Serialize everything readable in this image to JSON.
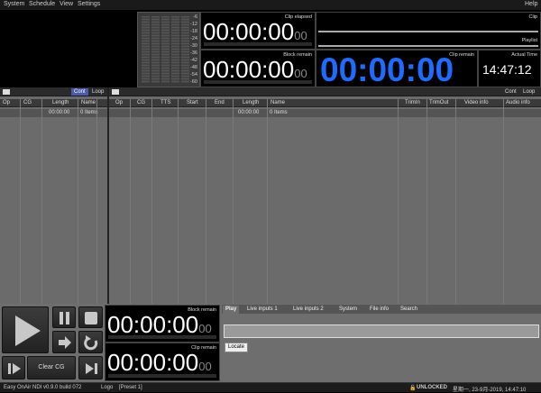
{
  "menu": {
    "items": [
      "System",
      "Schedule",
      "View",
      "Settings"
    ],
    "help": "Help"
  },
  "vu_scale": [
    "-6",
    "-12",
    "-18",
    "-24",
    "-30",
    "-36",
    "-42",
    "-48",
    "-54",
    "-60"
  ],
  "timers": {
    "clip_elapsed": {
      "label": "Clip elapsed",
      "main": "00:00:00",
      "frames": "00"
    },
    "block_remain": {
      "label": "Block remain",
      "main": "00:00:00",
      "frames": "00"
    },
    "clip_remain": {
      "label": "Clip remain",
      "value": "00:00:00"
    },
    "clip_label": "Clip",
    "playlist_label": "Playlist",
    "actual_time_label": "Actual Time",
    "actual_time": "14:47:12"
  },
  "left_pane": {
    "tabs": [
      "Cont",
      "Loop"
    ],
    "columns": [
      "Op",
      "CG",
      "Length",
      "Name"
    ],
    "summary": {
      "length": "00:00:00",
      "name": "0 Items"
    }
  },
  "right_pane": {
    "tabs": [
      "Cont",
      "Loop"
    ],
    "columns": [
      "Op",
      "CG",
      "TTS",
      "Start",
      "End",
      "Length",
      "Name",
      "TrimIn",
      "TrimOut",
      "Video info",
      "Audio info"
    ],
    "summary": {
      "length": "00:00:00",
      "name": "0 Items"
    }
  },
  "bottom": {
    "block_remain": {
      "label": "Block remain",
      "main": "00:00:00",
      "frames": "00"
    },
    "clip_remain": {
      "label": "Clip remain",
      "main": "00:00:00",
      "frames": "00"
    },
    "clear_cg": "Clear CG",
    "tabs": [
      "Play",
      "Live inputs 1",
      "Live inputs 2",
      "System",
      "File info",
      "Search"
    ],
    "locate": "Locate"
  },
  "status": {
    "app": "Easy OnAir NDI v0.9.0 build 072",
    "logo": "Logo",
    "preset": "[Preset 1]",
    "lock": "UNLOCKED",
    "datetime": "星期一, 23-9月-2019, 14:47:10"
  }
}
